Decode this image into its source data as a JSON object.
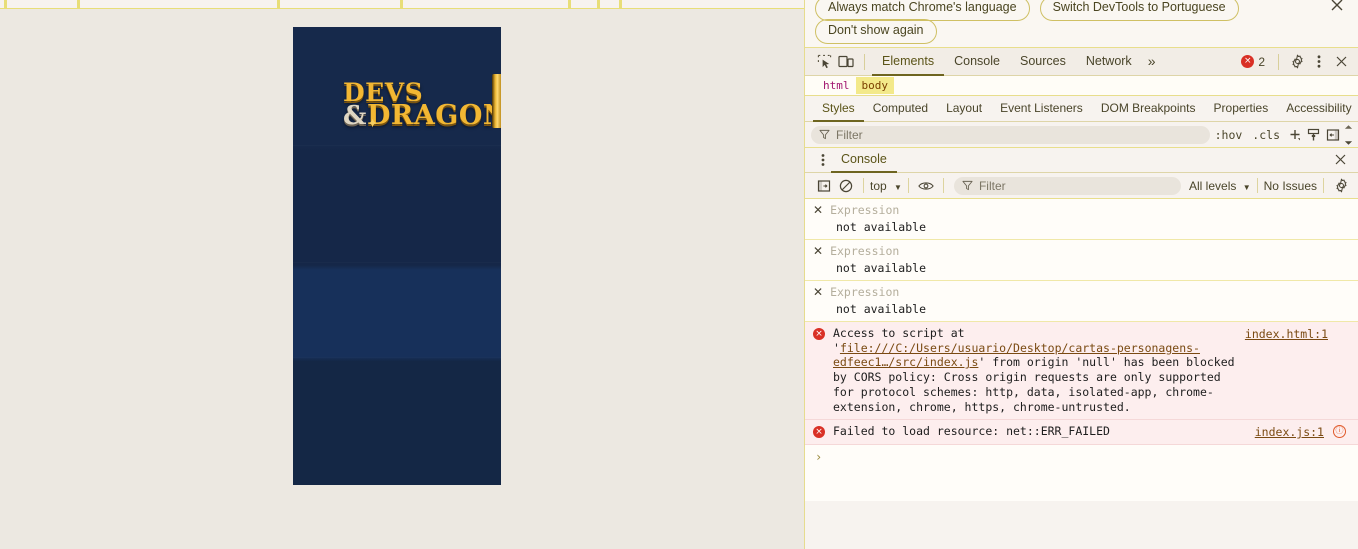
{
  "page": {
    "card": {
      "logo_line1": "DEVS",
      "logo_amp": "&",
      "logo_line2": "DRAGONS"
    },
    "tab_ticks": [
      4,
      77,
      277,
      400,
      568,
      597,
      619,
      922,
      944,
      966,
      1143,
      1265,
      1348
    ]
  },
  "devtools": {
    "language_bar": {
      "always_match": "Always match Chrome's language",
      "switch_lang": "Switch DevTools to Portuguese",
      "dont_show": "Don't show again",
      "close_icon": "close-icon"
    },
    "toolbar": {
      "inspect_icon": "inspect-element-icon",
      "device_icon": "device-toolbar-icon",
      "tabs": [
        {
          "label": "Elements",
          "active": true
        },
        {
          "label": "Console",
          "active": false
        },
        {
          "label": "Sources",
          "active": false
        },
        {
          "label": "Network",
          "active": false
        }
      ],
      "more_tabs": "»",
      "error_count": "2",
      "error_mark": "×",
      "settings_icon": "gear-icon",
      "more_icon": "kebab-menu-icon",
      "close_icon": "close-icon"
    },
    "breadcrumb": [
      {
        "label": "html",
        "selected": false
      },
      {
        "label": "body",
        "selected": true
      }
    ],
    "styles_tabs": [
      {
        "label": "Styles",
        "active": true
      },
      {
        "label": "Computed",
        "active": false
      },
      {
        "label": "Layout",
        "active": false
      },
      {
        "label": "Event Listeners",
        "active": false
      },
      {
        "label": "DOM Breakpoints",
        "active": false
      },
      {
        "label": "Properties",
        "active": false
      },
      {
        "label": "Accessibility",
        "active": false
      }
    ],
    "styles_filter": {
      "filter_icon": "filter-icon",
      "placeholder": "Filter",
      "value": "",
      "hov": ":hov",
      "cls": ".cls",
      "new_rule_icon": "new-style-rule-icon",
      "class_icon": "element-classes-icon",
      "sidebar_icon": "computed-sidebar-icon",
      "scroll_up_icon": "scroll-up-icon",
      "scroll_down_icon": "scroll-down-icon"
    },
    "drawer": {
      "menu_icon": "kebab-menu-icon",
      "tab_label": "Console",
      "close_icon": "close-icon"
    },
    "console_toolbar": {
      "sidebar_icon": "console-sidebar-icon",
      "clear_icon": "clear-console-icon",
      "context": "top",
      "context_caret": "▼",
      "eye_icon": "live-expression-icon",
      "filter_icon": "filter-icon",
      "filter_placeholder": "Filter",
      "filter_value": "",
      "levels": "All levels",
      "levels_caret": "▼",
      "issues": "No Issues",
      "settings_icon": "gear-icon"
    },
    "console_messages": [
      {
        "type": "live-expression",
        "close_mark": "✕",
        "label": "Expression",
        "value": "not available"
      },
      {
        "type": "live-expression",
        "close_mark": "✕",
        "label": "Expression",
        "value": "not available"
      },
      {
        "type": "live-expression",
        "close_mark": "✕",
        "label": "Expression",
        "value": "not available"
      },
      {
        "type": "error",
        "icon_mark": "×",
        "text_before": "Access to script at '",
        "url": "file:///C:/Users/usuario/Desktop/cartas-personagens-edfeec1…/src/index.js",
        "text_after": "' from origin 'null' has been blocked by CORS policy: Cross origin requests are only supported for protocol schemes: http, data, isolated-app, chrome-extension, chrome, https, chrome-untrusted.",
        "source": "index.html:1"
      },
      {
        "type": "error",
        "icon_mark": "×",
        "text": "Failed to load resource: net::ERR_FAILED",
        "source": "index.js:1",
        "issue_badge": "ⓘ"
      }
    ],
    "prompt": "›"
  },
  "colors": {
    "card_bg": "#15294a",
    "gold": "#f2b733",
    "accent_border": "#e8de8c",
    "error_red": "#d93025",
    "panel_bg": "#f7f3ef",
    "page_bg": "#ece8e1"
  }
}
